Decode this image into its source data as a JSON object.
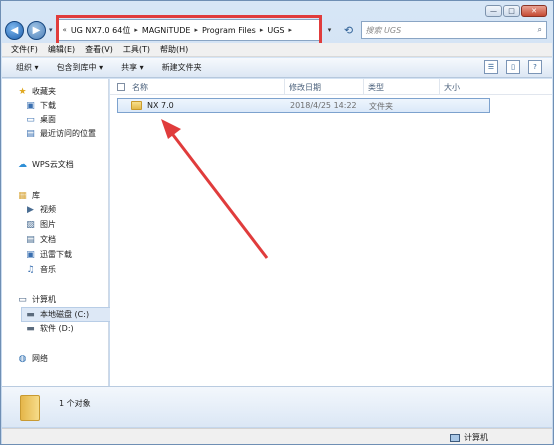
{
  "window": {
    "caption_buttons": [
      "—",
      "□",
      "✕"
    ]
  },
  "address_bar": {
    "chevron": "«",
    "crumbs": [
      "UG NX7.0 64位",
      "MAGNiTUDE",
      "Program Files",
      "UGS"
    ],
    "separator": "▸",
    "dropdown": "▾",
    "refresh": "⟲"
  },
  "search": {
    "placeholder": "搜索 UGS",
    "icon": "search-icon"
  },
  "menu": [
    "文件(F)",
    "编辑(E)",
    "查看(V)",
    "工具(T)",
    "帮助(H)"
  ],
  "toolbar": {
    "organize": "组织 ▾",
    "include_in_library": "包含到库中 ▾",
    "share": "共享 ▾",
    "new_folder": "新建文件夹"
  },
  "nav": {
    "favorites": "收藏夹",
    "downloads": "下载",
    "desktop": "桌面",
    "recent": "最近访问的位置",
    "wps": "WPS云文档",
    "libraries": "库",
    "videos": "视频",
    "pictures": "图片",
    "documents": "文档",
    "thunder": "迅雷下载",
    "music": "音乐",
    "computer": "计算机",
    "local_c": "本地磁盘 (C:)",
    "soft_d": "软件 (D:)",
    "network": "网络"
  },
  "columns": {
    "name": "名称",
    "modified": "修改日期",
    "type": "类型",
    "size": "大小"
  },
  "files": [
    {
      "name": "NX 7.0",
      "modified": "2018/4/25 14:22",
      "type": "文件夹",
      "size": ""
    }
  ],
  "details": {
    "count": "1 个对象"
  },
  "status": {
    "computer": "计算机"
  },
  "colors": {
    "highlight_box": "#e03c3c",
    "arrow": "#e03c3c"
  }
}
